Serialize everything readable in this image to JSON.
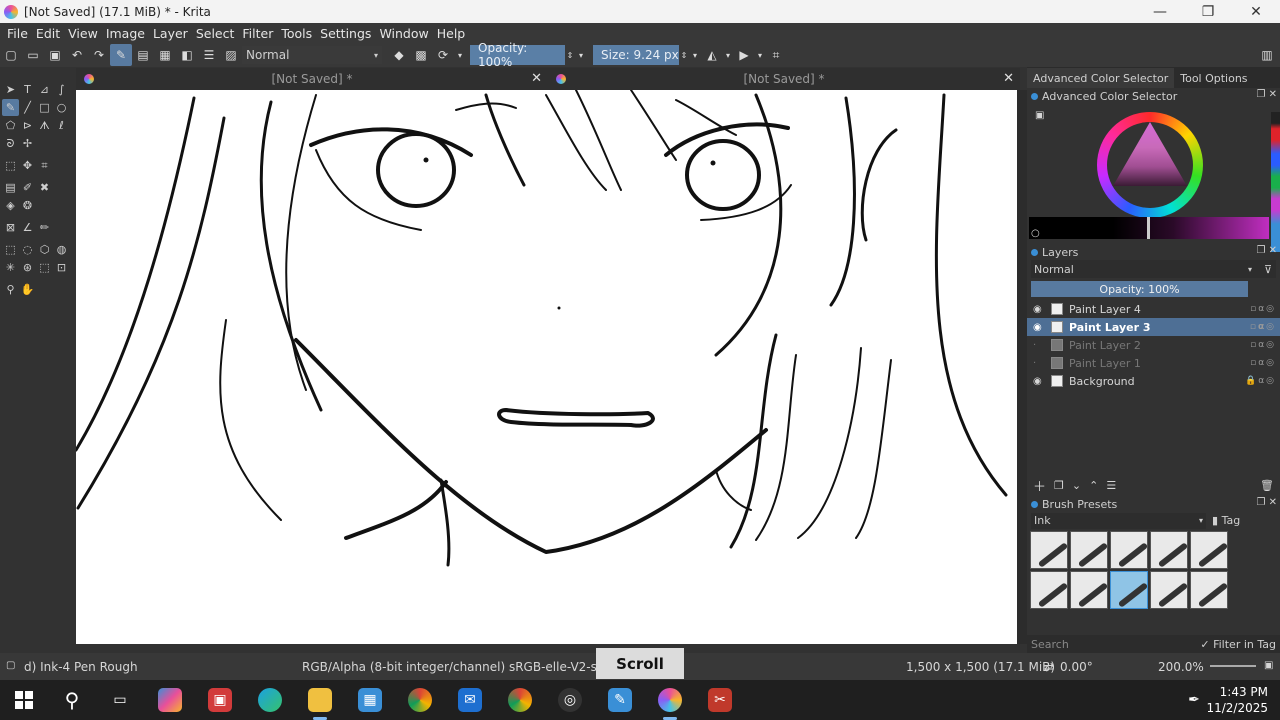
{
  "window": {
    "title": "[Not Saved]  (17.1 MiB)  * - Krita",
    "min_glyph": "—",
    "max_glyph": "❐",
    "close_glyph": "✕"
  },
  "menu": [
    "File",
    "Edit",
    "View",
    "Image",
    "Layer",
    "Select",
    "Filter",
    "Tools",
    "Settings",
    "Window",
    "Help"
  ],
  "toolbar": {
    "blend_mode": "Normal",
    "opacity_label": "Opacity: 100%",
    "size_label": "Size: 9.24 px"
  },
  "tabs": [
    {
      "label": "[Not Saved]  *",
      "close": "✕"
    },
    {
      "label": "[Not Saved]  *",
      "close": "✕"
    }
  ],
  "dock": {
    "tab_color_selector": "Advanced Color Selector",
    "tab_tool_options": "Tool Options",
    "color_panel_title": "Advanced Color Selector",
    "layers_title": "Layers",
    "layers_blend": "Normal",
    "layers_opacity": "Opacity:  100%",
    "layers": [
      {
        "name": "Paint Layer 4",
        "visible": true,
        "selected": false
      },
      {
        "name": "Paint Layer 3",
        "visible": true,
        "selected": true
      },
      {
        "name": "Paint Layer 2",
        "visible": false,
        "selected": false
      },
      {
        "name": "Paint Layer 1",
        "visible": false,
        "selected": false
      },
      {
        "name": "Background",
        "visible": true,
        "selected": false
      }
    ],
    "brush_presets_title": "Brush Presets",
    "brush_filter": "Ink",
    "brush_tag": "Tag",
    "brush_search_placeholder": "Search",
    "filter_in_tag": "✓ Filter in Tag"
  },
  "status": {
    "brush": "d) Ink-4 Pen Rough",
    "color_model": "RGB/Alpha (8-bit integer/channel)  sRGB-elle-V2-srgbtrc",
    "scroll_overlay": "Scroll",
    "image_size": "1,500 x 1,500 (17.1 MiB)",
    "rotation": "0.00°",
    "zoom": "200.0%"
  },
  "taskbar": {
    "time": "1:43 PM",
    "date": "11/2/2025"
  },
  "colors": {
    "accent": "#587aa0",
    "selected_layer": "#4e6f95",
    "panel_bg": "#323232"
  }
}
